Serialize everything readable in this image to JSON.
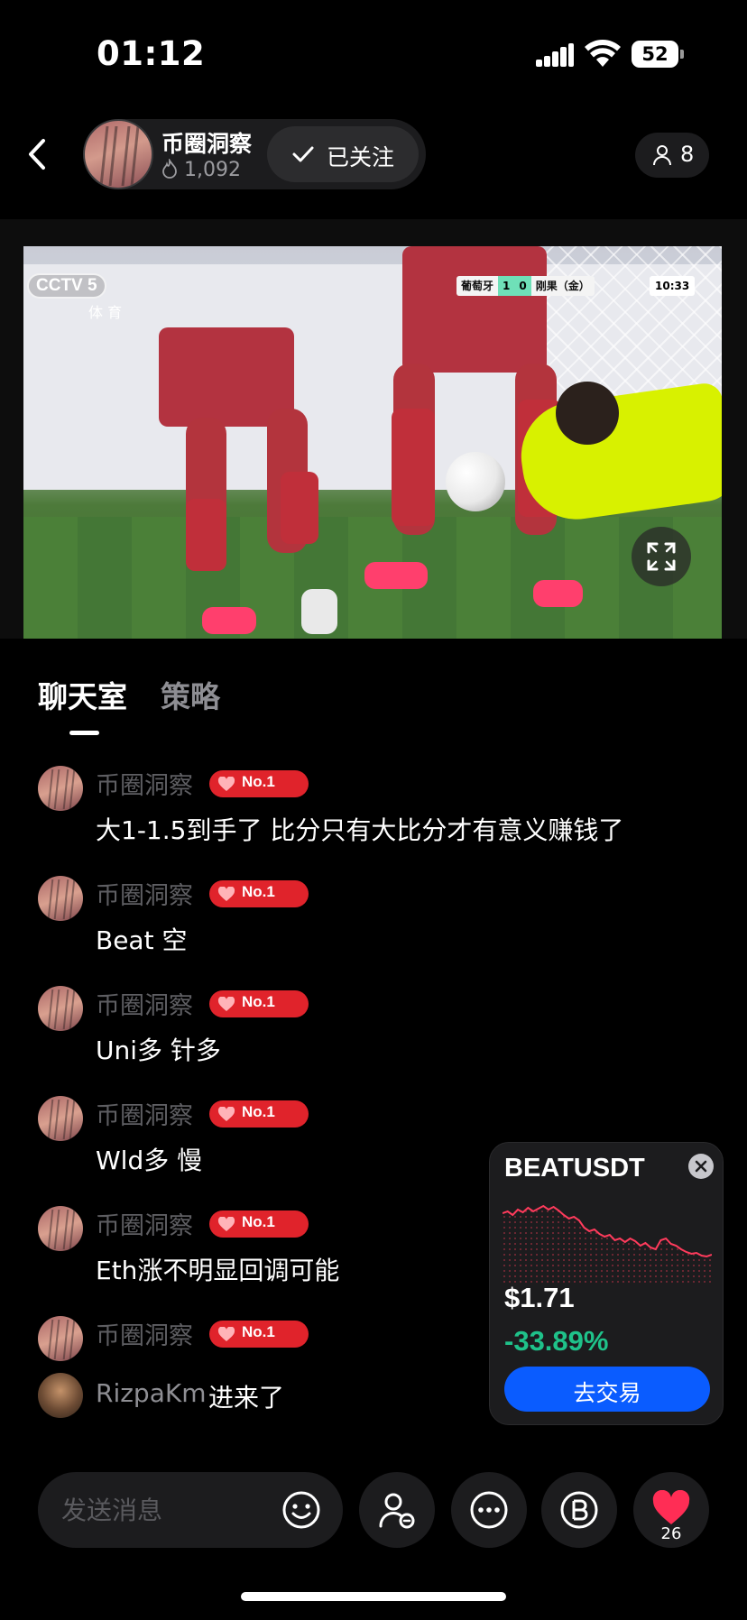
{
  "status_bar": {
    "time": "01:12",
    "battery": "52"
  },
  "header": {
    "host_name": "币圈洞察",
    "heat": "1,092",
    "follow_label": "已关注",
    "viewer_count": "8"
  },
  "video": {
    "channel": "CCTV 5",
    "channel_sub": "体 育",
    "team_home": "葡萄牙",
    "score_home": "1",
    "score_away": "0",
    "team_away": "刚果（金）",
    "clock": "10:33"
  },
  "tabs": [
    {
      "label": "聊天室",
      "active": true
    },
    {
      "label": "策略",
      "active": false
    }
  ],
  "messages": [
    {
      "user": "币圈洞察",
      "badge": "No.1",
      "text": "大1-1.5到手了 比分只有大比分才有意义赚钱了"
    },
    {
      "user": "币圈洞察",
      "badge": "No.1",
      "text": "Beat 空"
    },
    {
      "user": "币圈洞察",
      "badge": "No.1",
      "text": "Uni多 针多"
    },
    {
      "user": "币圈洞察",
      "badge": "No.1",
      "text": "Wld多 慢"
    },
    {
      "user": "币圈洞察",
      "badge": "No.1",
      "text": "Eth涨不明显回调可能"
    },
    {
      "user": "币圈洞察",
      "badge": "No.1",
      "text": ""
    }
  ],
  "join_event": {
    "user": "RizpaKm",
    "action": "进来了"
  },
  "ticker": {
    "symbol": "BEATUSDT",
    "price": "$1.71",
    "change": "-33.89%",
    "trade_label": "去交易",
    "change_color": "#1fc28a",
    "line_color": "#ff3b5c",
    "sparkline": [
      0.78,
      0.8,
      0.76,
      0.82,
      0.79,
      0.84,
      0.8,
      0.83,
      0.86,
      0.82,
      0.85,
      0.81,
      0.76,
      0.72,
      0.74,
      0.7,
      0.62,
      0.58,
      0.6,
      0.55,
      0.52,
      0.54,
      0.48,
      0.5,
      0.46,
      0.5,
      0.47,
      0.42,
      0.45,
      0.4,
      0.38,
      0.48,
      0.5,
      0.44,
      0.42,
      0.38,
      0.35,
      0.33,
      0.34,
      0.31,
      0.3,
      0.32
    ]
  },
  "bottom_bar": {
    "input_placeholder": "发送消息",
    "like_count": "26",
    "accent": "#ff2d55"
  }
}
